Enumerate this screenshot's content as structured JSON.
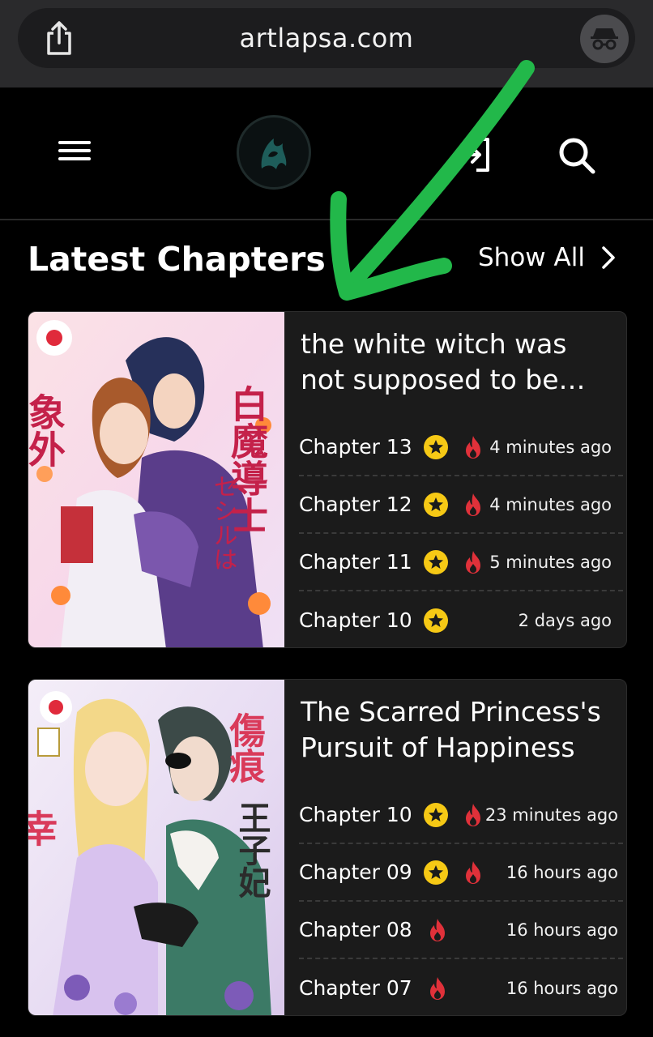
{
  "browser": {
    "url": "artlapsa.com",
    "share_icon": "share-icon",
    "incognito_icon": "incognito-icon"
  },
  "nav": {
    "menu_icon": "hamburger-menu-icon",
    "logo_icon": "site-logo",
    "login_icon": "login-icon",
    "search_icon": "search-icon"
  },
  "section": {
    "title": "Latest Chapters",
    "show_all": "Show All"
  },
  "series": [
    {
      "title_line1": "the white witch was",
      "title_line2": "not supposed to be…",
      "chapters": [
        {
          "name": "Chapter 13",
          "star": true,
          "fire": true,
          "time": "4 minutes ago"
        },
        {
          "name": "Chapter 12",
          "star": true,
          "fire": true,
          "time": "4 minutes ago"
        },
        {
          "name": "Chapter 11",
          "star": true,
          "fire": true,
          "time": "5 minutes ago"
        },
        {
          "name": "Chapter 10",
          "star": true,
          "fire": false,
          "time": "2 days ago"
        }
      ]
    },
    {
      "title_line1": "The Scarred Princess's",
      "title_line2": "Pursuit of Happiness",
      "chapters": [
        {
          "name": "Chapter 10",
          "star": true,
          "fire": true,
          "time": "23 minutes ago"
        },
        {
          "name": "Chapter 09",
          "star": true,
          "fire": true,
          "time": "16 hours ago"
        },
        {
          "name": "Chapter 08",
          "star": false,
          "fire": true,
          "time": "16 hours ago"
        },
        {
          "name": "Chapter 07",
          "star": false,
          "fire": true,
          "time": "16 hours ago"
        }
      ]
    }
  ],
  "colors": {
    "star": "#f6c915",
    "fire": "#e0313a",
    "arrow": "#22b84a"
  }
}
